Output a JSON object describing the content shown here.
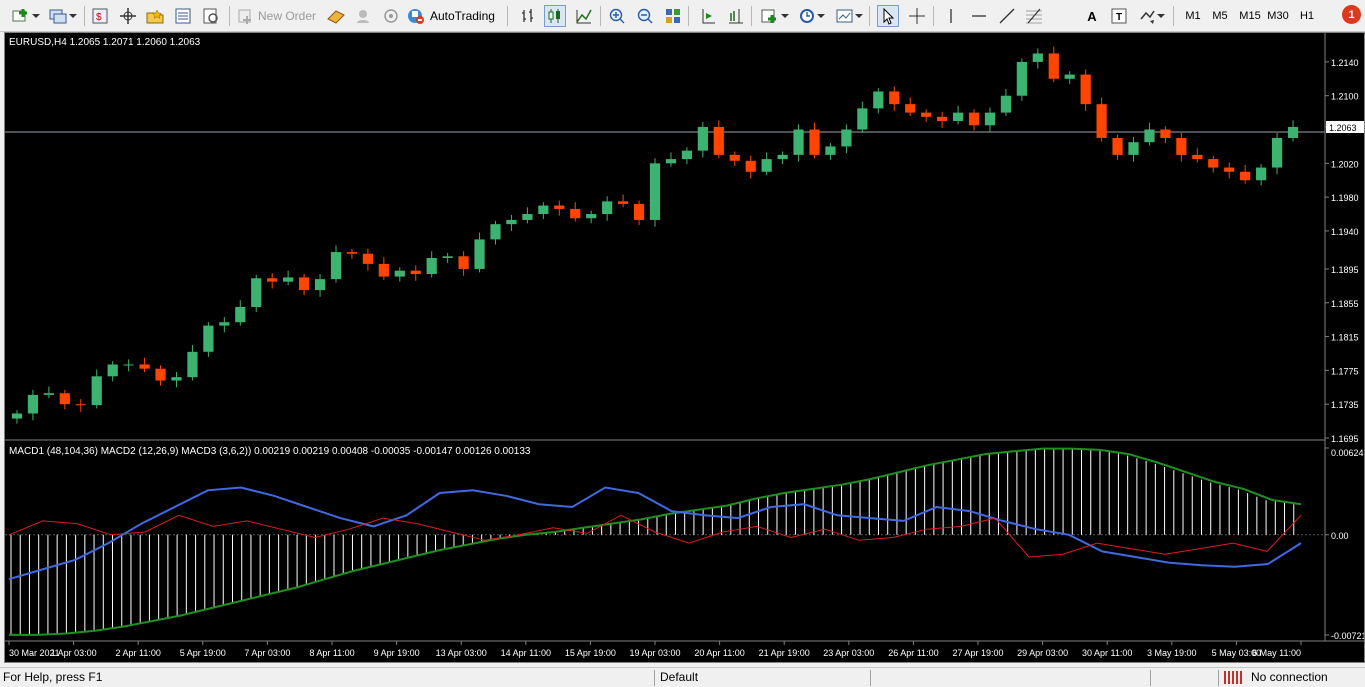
{
  "toolbar": {
    "new_order_label": "New Order",
    "autotrading_label": "AutoTrading",
    "timeframes": [
      "M1",
      "M5",
      "M15",
      "M30",
      "H1"
    ],
    "notification_count": "1",
    "icons": [
      "new-chart-icon",
      "profiles-icon",
      "market-watch-icon",
      "navigator-icon",
      "favorites-icon",
      "data-window-icon",
      "strategy-tester-icon",
      "new-order-icon",
      "metaeditor-icon",
      "signals-icon",
      "radio-icon",
      "autotrading-icon",
      "bar-chart-icon",
      "candlestick-icon",
      "line-chart-icon",
      "zoom-in-icon",
      "zoom-out-icon",
      "tile-windows-icon",
      "autoscroll-icon",
      "chart-shift-icon",
      "indicators-icon",
      "periods-icon",
      "templates-icon",
      "cursor-icon",
      "crosshair-icon",
      "vertical-line-icon",
      "horizontal-line-icon",
      "trendline-icon",
      "fibonacci-icon",
      "text-icon",
      "text-label-icon",
      "arrows-icon"
    ]
  },
  "chart": {
    "symbol_info": "EURUSD,H4  1.2065 1.2071 1.2060 1.2063",
    "current_price": "1.2063",
    "price_ticks": [
      "1.2140",
      "1.2100",
      "1.2063",
      "1.2020",
      "1.1980",
      "1.1940",
      "1.1895",
      "1.1855",
      "1.1815",
      "1.1775",
      "1.1735",
      "1.1695"
    ],
    "indicator_info": "MACD1 (48,104,36) MACD2 (12,26,9) MACD3 (3,6,2)) 0.00219 0.00219 0.00408 -0.00035 -0.00147 0.00126 0.00133",
    "indicator_ticks": [
      "0.00624",
      "0.00",
      "-0.00721"
    ],
    "time_labels": [
      "30 Mar 2021",
      "1 Apr 03:00",
      "2 Apr 11:00",
      "5 Apr 19:00",
      "7 Apr 03:00",
      "8 Apr 11:00",
      "9 Apr 19:00",
      "13 Apr 03:00",
      "14 Apr 11:00",
      "15 Apr 19:00",
      "19 Apr 03:00",
      "20 Apr 11:00",
      "21 Apr 19:00",
      "23 Apr 03:00",
      "26 Apr 11:00",
      "27 Apr 19:00",
      "29 Apr 03:00",
      "30 Apr 11:00",
      "3 May 19:00",
      "5 May 03:00",
      "6 May 11:00"
    ],
    "colors": {
      "bull": "#3cb371",
      "bear": "#ff4500",
      "background": "#000000",
      "axis_text": "#ffffff",
      "histogram": "#ffffff",
      "macd_main": "#4169e1",
      "signal_green": "#1f8f1f",
      "red_line": "#dc1e1e"
    }
  },
  "chart_data": [
    {
      "type": "candlestick",
      "symbol": "EURUSD",
      "timeframe": "H4",
      "ylim": [
        1.1695,
        1.216
      ],
      "x_start": "30 Mar 2021",
      "x_end": "6 May 11:00",
      "closes": [
        1.1724,
        1.1746,
        1.1748,
        1.1735,
        1.1734,
        1.1768,
        1.1782,
        1.1782,
        1.1777,
        1.1763,
        1.1767,
        1.1797,
        1.1828,
        1.1832,
        1.185,
        1.1884,
        1.188,
        1.1885,
        1.187,
        1.1883,
        1.1915,
        1.1913,
        1.1901,
        1.1886,
        1.1893,
        1.1889,
        1.1908,
        1.191,
        1.1895,
        1.193,
        1.1948,
        1.1953,
        1.196,
        1.197,
        1.1966,
        1.1955,
        1.196,
        1.1975,
        1.1972,
        1.1953,
        1.202,
        1.2025,
        1.2035,
        1.2063,
        1.203,
        1.2023,
        1.201,
        1.2025,
        1.203,
        1.206,
        1.203,
        1.204,
        1.206,
        1.2085,
        1.2105,
        1.209,
        1.208,
        1.2075,
        1.207,
        1.208,
        1.2065,
        1.208,
        1.21,
        1.214,
        1.215,
        1.212,
        1.2125,
        1.209,
        1.205,
        1.203,
        1.2045,
        1.206,
        1.205,
        1.203,
        1.2025,
        1.2015,
        1.201,
        1.2,
        1.2015,
        1.205,
        1.2063
      ]
    },
    {
      "type": "line",
      "title": "MACD1 (48,104,36) MACD2 (12,26,9) MACD3 (3,6,2))",
      "ylim": [
        -0.00721,
        0.00624
      ],
      "series": [
        {
          "style": "histogram",
          "color": "#ffffff",
          "values": [
            -0.0072,
            -0.0072,
            -0.0071,
            -0.0069,
            -0.0066,
            -0.0062,
            -0.0058,
            -0.0053,
            -0.0048,
            -0.0043,
            -0.0038,
            -0.0032,
            -0.0026,
            -0.0021,
            -0.0016,
            -0.0011,
            -0.0007,
            -0.0003,
            0.0,
            0.0002,
            0.0005,
            0.0008,
            0.0011,
            0.0015,
            0.0018,
            0.0021,
            0.0026,
            0.003,
            0.0033,
            0.0036,
            0.004,
            0.0045,
            0.005,
            0.0054,
            0.0058,
            0.006,
            0.0062,
            0.0062,
            0.0061,
            0.0058,
            0.0052,
            0.0045,
            0.0038,
            0.0033,
            0.0025,
            0.0022
          ]
        },
        {
          "style": "line",
          "color": "#1f8f1f",
          "values": [
            -0.0072,
            -0.0072,
            -0.0071,
            -0.0069,
            -0.0066,
            -0.0062,
            -0.0058,
            -0.0053,
            -0.0048,
            -0.0043,
            -0.0038,
            -0.0032,
            -0.0026,
            -0.0021,
            -0.0016,
            -0.0011,
            -0.0007,
            -0.0003,
            0.0,
            0.0002,
            0.0005,
            0.0008,
            0.0011,
            0.0015,
            0.0018,
            0.0021,
            0.0026,
            0.003,
            0.0033,
            0.0036,
            0.004,
            0.0045,
            0.005,
            0.0054,
            0.0058,
            0.006,
            0.0062,
            0.0062,
            0.0061,
            0.0058,
            0.0052,
            0.0045,
            0.0038,
            0.0033,
            0.0025,
            0.0022
          ]
        },
        {
          "style": "line",
          "color": "#4169e1",
          "values": [
            -0.0032,
            -0.0025,
            -0.0018,
            -0.0006,
            0.0008,
            0.002,
            0.0032,
            0.0034,
            0.0028,
            0.002,
            0.0012,
            0.0006,
            0.0014,
            0.003,
            0.0032,
            0.0028,
            0.0022,
            0.002,
            0.0034,
            0.003,
            0.0017,
            0.0014,
            0.0012,
            0.002,
            0.0022,
            0.0014,
            0.0012,
            0.001,
            0.002,
            0.0017,
            0.001,
            0.0004,
            0.0,
            -0.0012,
            -0.0016,
            -0.002,
            -0.0022,
            -0.0023,
            -0.0021,
            -0.0006
          ]
        },
        {
          "style": "line",
          "color": "#dc1e1e",
          "values": [
            0.0,
            0.001,
            0.0008,
            0.0,
            0.0002,
            0.0014,
            0.0006,
            0.001,
            0.0004,
            -0.0002,
            0.0004,
            0.0012,
            0.0008,
            0.0002,
            -0.0004,
            0.0,
            0.0005,
            0.0001,
            0.0014,
            0.0002,
            -0.0006,
            0.0002,
            0.0006,
            -0.0002,
            0.0004,
            -0.0004,
            -0.0002,
            0.0004,
            0.0006,
            0.0012,
            -0.0016,
            -0.0014,
            -0.0006,
            -0.001,
            -0.0014,
            -0.001,
            -0.0006,
            -0.0012,
            0.0014
          ]
        }
      ]
    }
  ],
  "status": {
    "help_text": "For Help, press F1",
    "profile": "Default",
    "connection": "No connection"
  }
}
